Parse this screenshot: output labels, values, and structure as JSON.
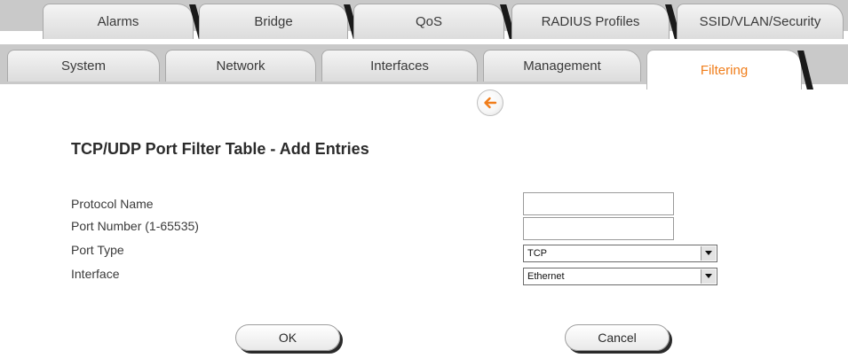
{
  "tabs_top": [
    "Alarms",
    "Bridge",
    "QoS",
    "RADIUS Profiles",
    "SSID/VLAN/Security"
  ],
  "tabs_bottom": [
    "System",
    "Network",
    "Interfaces",
    "Management",
    "Filtering"
  ],
  "active_tab": "Filtering",
  "back_icon": "left-arrow-icon",
  "page": {
    "title": "TCP/UDP Port Filter Table - Add Entries"
  },
  "form": {
    "protocol_name": {
      "label": "Protocol Name",
      "value": ""
    },
    "port_number": {
      "label": "Port Number (1-65535)",
      "value": ""
    },
    "port_type": {
      "label": "Port Type",
      "value": "TCP"
    },
    "interface": {
      "label": "Interface",
      "value": "Ethernet"
    }
  },
  "buttons": {
    "ok": "OK",
    "cancel": "Cancel"
  },
  "colors": {
    "accent": "#f07d1a",
    "tab_bg": "#c9c9c9"
  }
}
